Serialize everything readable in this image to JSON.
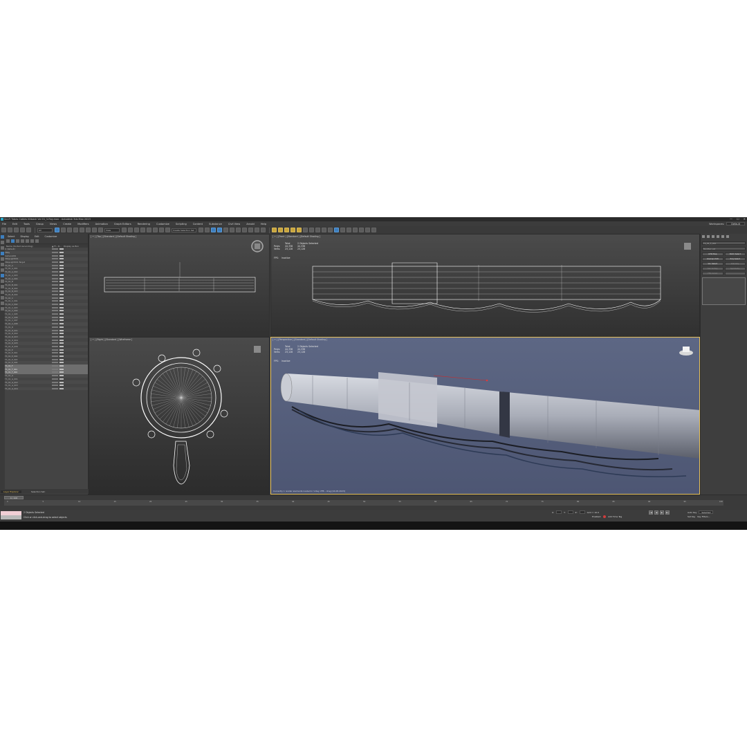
{
  "window": {
    "title": "Sci-Fi Tubes Cables Kitbash Vol 01_V-Ray.max - Autodesk 3ds Max 2023",
    "controls": [
      "—",
      "☐",
      "✕"
    ]
  },
  "menu": [
    "File",
    "Edit",
    "Tools",
    "Group",
    "Views",
    "Create",
    "Modifiers",
    "Animation",
    "Graph Editors",
    "Rendering",
    "Customize",
    "Scripting",
    "Content",
    "Substance",
    "Civil View",
    "Arnold",
    "Help"
  ],
  "workspace": {
    "label": "Workspaces:",
    "value": "Default"
  },
  "toolbar": {
    "selection_filter": "All",
    "view_select": "View",
    "named_sets": "Create Selection Set"
  },
  "explorer": {
    "tabs": [
      "Select",
      "Display",
      "Edit",
      "Customize"
    ],
    "columns": [
      "Name (Sorted Ascending)",
      "▲ Fr...",
      "R...",
      "Display as Box"
    ],
    "rows": [
      {
        "name": "0 (default)",
        "sel": false
      },
      {
        "name": "  VRay",
        "sel": false
      },
      {
        "name": "    Camera001",
        "sel": false
      },
      {
        "name": "    VRayLight001",
        "sel": false
      },
      {
        "name": "    VRayLight001.Target",
        "sel": false
      },
      {
        "name": "TS_01_A",
        "sel": false
      },
      {
        "name": "    TS_01_A_001",
        "sel": false
      },
      {
        "name": "    TS_01_A_002",
        "sel": false
      },
      {
        "name": "    TS_01_A_003",
        "sel": false
      },
      {
        "name": "    TS_01_A_004",
        "sel": false
      },
      {
        "name": "TS_01_B",
        "sel": false
      },
      {
        "name": "    TS_01_B_001",
        "sel": false
      },
      {
        "name": "    TS_01_B_002",
        "sel": false
      },
      {
        "name": "    TS_01_B_003",
        "sel": false
      },
      {
        "name": "    TS_01_B_004",
        "sel": false
      },
      {
        "name": "TS_01_C",
        "sel": false
      },
      {
        "name": "    TS_01_C_001",
        "sel": false
      },
      {
        "name": "    TS_01_C_002",
        "sel": false
      },
      {
        "name": "    TS_01_C_003",
        "sel": false
      },
      {
        "name": "    TS_01_C_004",
        "sel": false
      },
      {
        "name": "    TS_01_C_005",
        "sel": false
      },
      {
        "name": "    TS_01_C_006",
        "sel": false
      },
      {
        "name": "    TS_01_C_007",
        "sel": false
      },
      {
        "name": "    TS_01_C_008",
        "sel": false
      },
      {
        "name": "TS_01_D",
        "sel": false
      },
      {
        "name": "    TS_01_D_001",
        "sel": false
      },
      {
        "name": "    TS_01_D_002",
        "sel": false
      },
      {
        "name": "    TS_01_D_003",
        "sel": false
      },
      {
        "name": "    TS_01_D_004",
        "sel": false
      },
      {
        "name": "    TS_01_D_005",
        "sel": false
      },
      {
        "name": "    TS_01_D_006",
        "sel": false
      },
      {
        "name": "TS_01_E",
        "sel": false
      },
      {
        "name": "    TS_01_E_001",
        "sel": false
      },
      {
        "name": "    TS_01_E_002",
        "sel": false
      },
      {
        "name": "    TS_01_E_003",
        "sel": false
      },
      {
        "name": "    TS_01_E_004",
        "sel": false
      },
      {
        "name": "TS_01_F",
        "sel": true
      },
      {
        "name": "    TS_01_F_001",
        "sel": true
      },
      {
        "name": "    TS_01_F_002",
        "sel": true
      },
      {
        "name": "TS_01_G",
        "sel": false
      },
      {
        "name": "    TS_01_G_001",
        "sel": false
      },
      {
        "name": "    TS_01_G_002",
        "sel": false
      },
      {
        "name": "    TS_01_G_003",
        "sel": false
      },
      {
        "name": "    TS_01_G_004",
        "sel": false
      }
    ],
    "footer_left": "Layer Explorer",
    "footer_right": "Selection Set:"
  },
  "viewports": {
    "top": "[ + ] [Top ] [Standard ] [Default Shading ]",
    "front": "[ + ] [Front ] [Standard ] [Default Shading ]",
    "right": "[ + ] [Right ] [Standard ] [Wireframe ]",
    "persp": "[ + ] [Perspective ] [Standard ] [Default Shading ]",
    "stats": {
      "total_label": "Total",
      "selected_label": "2 Objects Selected",
      "polys_label": "Polys:",
      "polys_total": "44,338",
      "polys_sel": "44,338",
      "verts_label": "Verts:",
      "verts_total": "23,128",
      "verts_sel": "23,128",
      "fps_label": "FPS:",
      "fps_value": "Inactive"
    },
    "persp_status": "Currently 1 render elements loaded in V-Ray VFB - drag [16.08.2023]"
  },
  "command_panel": {
    "object_field": "TS_01_F_002",
    "modifier_list": "Modifier List",
    "mods": [
      {
        "label": "UVW Map",
        "dim": false
      },
      {
        "label": "Patch Select",
        "dim": false
      },
      {
        "label": "Unwrap UVW",
        "dim": false
      },
      {
        "label": "Poly Select",
        "dim": false
      },
      {
        "label": "Vol. Select",
        "dim": false
      },
      {
        "label": "Edit Poly",
        "dim": true
      },
      {
        "label": "Turn to Poly",
        "dim": true
      },
      {
        "label": "Symmetry",
        "dim": true
      },
      {
        "label": "FFD 2x2x2",
        "dim": true
      },
      {
        "label": "",
        "dim": true
      }
    ]
  },
  "timeline": {
    "slider": "0 / 100",
    "ticks": [
      "0",
      "5",
      "10",
      "15",
      "20",
      "25",
      "30",
      "35",
      "40",
      "45",
      "50",
      "55",
      "60",
      "65",
      "70",
      "75",
      "80",
      "85",
      "90",
      "95",
      "100"
    ]
  },
  "status": {
    "selected": "2 Objects Selected",
    "prompt": "Click or click-and-drag to select objects",
    "x": "X:",
    "y": "Y:",
    "z": "Z:",
    "grid": "Grid = 10.0",
    "enabled": "Enabled:",
    "add_time_tag": "Add Time Tag",
    "auto_key": "Auto Key",
    "selected_opt": "Selected",
    "set_key": "Set Key",
    "key_filters": "Key Filters..."
  }
}
